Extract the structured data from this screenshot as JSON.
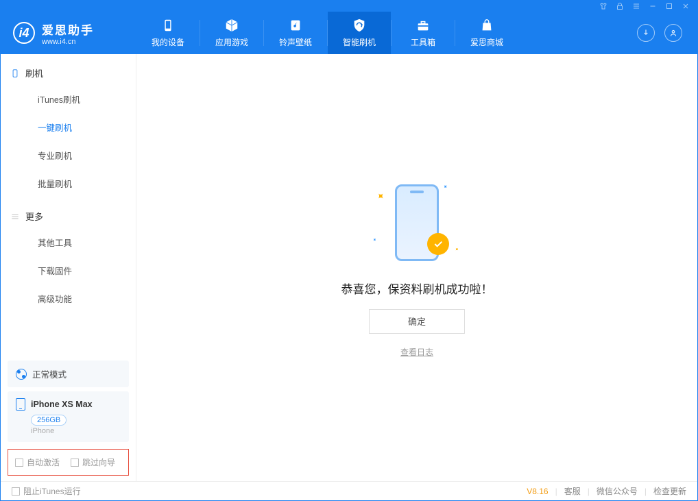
{
  "app": {
    "name": "爱思助手",
    "site": "www.i4.cn"
  },
  "nav": {
    "device": "我的设备",
    "apps": "应用游戏",
    "ring": "铃声壁纸",
    "flash": "智能刷机",
    "tools": "工具箱",
    "store": "爱思商城"
  },
  "sidebar": {
    "group_flash": "刷机",
    "items_flash": {
      "itunes": "iTunes刷机",
      "onekey": "一键刷机",
      "pro": "专业刷机",
      "batch": "批量刷机"
    },
    "group_more": "更多",
    "items_more": {
      "other": "其他工具",
      "firmware": "下载固件",
      "advanced": "高级功能"
    }
  },
  "device": {
    "mode": "正常模式",
    "name": "iPhone XS Max",
    "capacity": "256GB",
    "type": "iPhone"
  },
  "options": {
    "auto_activate": "自动激活",
    "skip_guide": "跳过向导"
  },
  "footer": {
    "block_itunes": "阻止iTunes运行",
    "version": "V8.16",
    "kefu": "客服",
    "wechat": "微信公众号",
    "update": "检查更新"
  },
  "main": {
    "success": "恭喜您，保资料刷机成功啦！",
    "ok": "确定",
    "log": "查看日志"
  }
}
